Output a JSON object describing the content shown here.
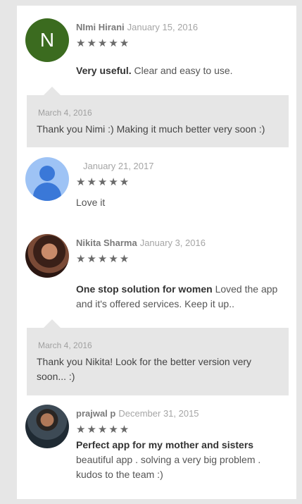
{
  "reviews": [
    {
      "avatar_letter": "N",
      "author": "NImi Hirani",
      "date": "January 15, 2016",
      "stars": "★★★★★",
      "title": "Very useful.",
      "text": "Clear and easy to use.",
      "reply": {
        "date": "March 4, 2016",
        "text": "Thank you Nimi :) Making it much better very soon :)"
      }
    },
    {
      "author": "",
      "date": "January 21, 2017",
      "stars": "★★★★★",
      "title": "",
      "text": "Love it"
    },
    {
      "author": "Nikita Sharma",
      "date": "January 3, 2016",
      "stars": "★★★★★",
      "title": "One stop solution for women",
      "text": "Loved the app and it's offered services. Keep it up..",
      "reply": {
        "date": "March 4, 2016",
        "text": "Thank you Nikita! Look for the better version very soon... :)"
      }
    },
    {
      "author": "prajwal p",
      "date": "December 31, 2015",
      "stars": "★★★★★",
      "title": "Perfect app for my mother and sisters",
      "text": "beautiful app . solving a very big problem . kudos to the team :)"
    }
  ]
}
